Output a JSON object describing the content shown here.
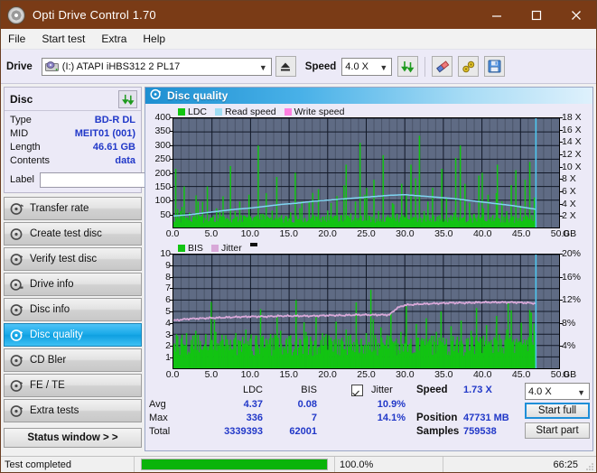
{
  "window": {
    "title": "Opti Drive Control 1.70",
    "icon": "disc-icon",
    "minimize": "minimize-icon",
    "maximize": "maximize-icon",
    "close": "close-icon"
  },
  "menu": {
    "items": [
      "File",
      "Start test",
      "Extra",
      "Help"
    ]
  },
  "toolbar": {
    "drive_label": "Drive",
    "drive_value": "(I:)  ATAPI iHBS312  2 PL17",
    "eject_icon": "eject-icon",
    "speed_label": "Speed",
    "speed_value": "4.0 X",
    "refresh_icon": "refresh-icon",
    "eraser_icon": "eraser-icon",
    "tools_icon": "tools-icon",
    "save_icon": "save-icon"
  },
  "disc_panel": {
    "title": "Disc",
    "refresh_icon": "refresh-icon",
    "rows": [
      {
        "key": "Type",
        "value": "BD-R DL"
      },
      {
        "key": "MID",
        "value": "MEIT01 (001)"
      },
      {
        "key": "Length",
        "value": "46.61 GB"
      },
      {
        "key": "Contents",
        "value": "data"
      }
    ],
    "label_key": "Label",
    "label_value": "",
    "label_placeholder": "",
    "disc_icon": "disc-small-icon"
  },
  "nav": {
    "items": [
      {
        "label": "Transfer rate",
        "icon": "disc-spin-icon",
        "active": false
      },
      {
        "label": "Create test disc",
        "icon": "disc-write-icon",
        "active": false
      },
      {
        "label": "Verify test disc",
        "icon": "disc-check-icon",
        "active": false
      },
      {
        "label": "Drive info",
        "icon": "drive-info-icon",
        "active": false
      },
      {
        "label": "Disc info",
        "icon": "disc-info-icon",
        "active": false
      },
      {
        "label": "Disc quality",
        "icon": "disc-quality-icon",
        "active": true
      },
      {
        "label": "CD Bler",
        "icon": "disc-bler-icon",
        "active": false
      },
      {
        "label": "FE / TE",
        "icon": "disc-fete-icon",
        "active": false
      },
      {
        "label": "Extra tests",
        "icon": "disc-extra-icon",
        "active": false
      }
    ],
    "status_button": "Status window > >"
  },
  "main": {
    "header_title": "Disc quality",
    "header_icon": "disc-quality-icon"
  },
  "stats": {
    "col_ldc": "LDC",
    "col_bis": "BIS",
    "row_avg": "Avg",
    "row_max": "Max",
    "row_total": "Total",
    "ldc_avg": "4.37",
    "ldc_max": "336",
    "ldc_total": "3339393",
    "bis_avg": "0.08",
    "bis_max": "7",
    "bis_total": "62001",
    "jitter_label": "Jitter",
    "jitter_checked": true,
    "jitter_avg": "10.9%",
    "jitter_max": "14.1%",
    "speed_label": "Speed",
    "speed_value": "1.73 X",
    "position_label": "Position",
    "position_value": "47731 MB",
    "samples_label": "Samples",
    "samples_value": "759538",
    "speed_select": "4.0 X",
    "start_full": "Start full",
    "start_part": "Start part"
  },
  "statusbar": {
    "message": "Test completed",
    "percent_label": "100.0%",
    "percent_value": 100,
    "elapsed": "66:25"
  },
  "colors": {
    "titlebar": "#7a3b16",
    "accent_blue": "#2138c8",
    "ldc_green": "#12c412",
    "read_speed": "#7fd4f0",
    "write_speed": "#ff7fe0",
    "bis_green": "#12c412",
    "jitter_pink": "#d8a8d8",
    "plot_bg": "#5f6b84",
    "progress_green": "#0ab40a",
    "nav_active": "#18a9e8"
  },
  "chart_data": [
    {
      "type": "line",
      "id": "top-chart",
      "title": "Disc quality",
      "legend": [
        {
          "name": "LDC",
          "color": "#12c412"
        },
        {
          "name": "Read speed",
          "color": "#7fd4f0"
        },
        {
          "name": "Write speed",
          "color": "#ff7fe0"
        }
      ],
      "legend_position": "top-left",
      "grid": true,
      "xlabel": "GB",
      "xlim": [
        0,
        50
      ],
      "xticks": [
        "0.0",
        "5.0",
        "10.0",
        "15.0",
        "20.0",
        "25.0",
        "30.0",
        "35.0",
        "40.0",
        "45.0",
        "50.0"
      ],
      "ylabel_left": "LDC",
      "ylim_left": [
        0,
        400
      ],
      "yticks_left": [
        "50",
        "100",
        "150",
        "200",
        "250",
        "300",
        "350",
        "400"
      ],
      "ylabel_right": "Speed",
      "ylim_right": [
        0,
        18
      ],
      "yticks_right": [
        "2 X",
        "4 X",
        "6 X",
        "8 X",
        "10 X",
        "12 X",
        "14 X",
        "16 X",
        "18 X"
      ],
      "series": [
        {
          "name": "Read speed",
          "color": "#7fd4f0",
          "axis": "right",
          "x": [
            0,
            2,
            4,
            6,
            8,
            10,
            12,
            14,
            16,
            18,
            20,
            22,
            24,
            26,
            28,
            30,
            32,
            34,
            36,
            38,
            40,
            42,
            44,
            46,
            47
          ],
          "values": [
            1.9,
            2.1,
            2.4,
            2.7,
            3.0,
            3.2,
            3.5,
            3.8,
            4.0,
            4.3,
            4.5,
            4.7,
            4.9,
            5.1,
            5.3,
            5.4,
            5.2,
            5.0,
            4.8,
            4.5,
            4.2,
            3.9,
            3.6,
            3.2,
            3.0
          ]
        },
        {
          "name": "LDC",
          "color": "#12c412",
          "axis": "left",
          "note": "dense vertical error spikes across 0-47 GB; baseline approx 20-60, peaks to 336",
          "baseline": 30,
          "peak_max": 336,
          "spikes": [
            [
              0.3,
              215
            ],
            [
              0.9,
              60
            ],
            [
              1.4,
              150
            ],
            [
              2.1,
              55
            ],
            [
              2.6,
              35
            ],
            [
              3.2,
              95
            ],
            [
              3.8,
              45
            ],
            [
              4.4,
              150
            ],
            [
              5.1,
              38
            ],
            [
              5.6,
              70
            ],
            [
              6.2,
              42
            ],
            [
              6.8,
              30
            ],
            [
              7.4,
              225
            ],
            [
              8.0,
              60
            ],
            [
              8.6,
              95
            ],
            [
              9.2,
              40
            ],
            [
              9.8,
              120
            ],
            [
              10.4,
              35
            ],
            [
              11.0,
              300
            ],
            [
              11.6,
              50
            ],
            [
              12.2,
              40
            ],
            [
              12.8,
              62
            ],
            [
              13.4,
              185
            ],
            [
              14.0,
              45
            ],
            [
              14.6,
              38
            ],
            [
              15.2,
              55
            ],
            [
              15.8,
              200
            ],
            [
              16.4,
              70
            ],
            [
              17.0,
              35
            ],
            [
              17.6,
              95
            ],
            [
              18.2,
              45
            ],
            [
              18.8,
              140
            ],
            [
              19.4,
              40
            ],
            [
              20.0,
              62
            ],
            [
              20.6,
              38
            ],
            [
              21.2,
              115
            ],
            [
              21.8,
              45
            ],
            [
              22.4,
              230
            ],
            [
              23.0,
              52
            ],
            [
              23.6,
              95
            ],
            [
              24.2,
              310
            ],
            [
              24.8,
              120
            ],
            [
              25.4,
              40
            ],
            [
              26.0,
              175
            ],
            [
              26.6,
              60
            ],
            [
              27.2,
              265
            ],
            [
              27.8,
              45
            ],
            [
              28.4,
              90
            ],
            [
              29.0,
              50
            ],
            [
              29.6,
              160
            ],
            [
              30.2,
              120
            ],
            [
              30.8,
              230
            ],
            [
              31.4,
              180
            ],
            [
              31.9,
              336
            ],
            [
              32.5,
              60
            ],
            [
              33.0,
              95
            ],
            [
              33.6,
              145
            ],
            [
              34.2,
              40
            ],
            [
              34.8,
              215
            ],
            [
              35.4,
              110
            ],
            [
              36.0,
              45
            ],
            [
              36.6,
              255
            ],
            [
              37.2,
              300
            ],
            [
              37.8,
              160
            ],
            [
              38.4,
              90
            ],
            [
              39.0,
              50
            ],
            [
              39.6,
              190
            ],
            [
              40.2,
              70
            ],
            [
              40.8,
              120
            ],
            [
              41.4,
              45
            ],
            [
              42.0,
              230
            ],
            [
              42.6,
              95
            ],
            [
              43.2,
              60
            ],
            [
              43.8,
              155
            ],
            [
              44.4,
              210
            ],
            [
              45.0,
              80
            ],
            [
              45.6,
              175
            ],
            [
              46.2,
              240
            ],
            [
              46.8,
              110
            ]
          ]
        },
        {
          "name": "Write speed",
          "color": "#ff7fe0",
          "axis": "right",
          "values": []
        }
      ],
      "markers": [
        {
          "type": "vline",
          "x": 47.0,
          "color": "#4ec8f0"
        }
      ]
    },
    {
      "type": "line",
      "id": "bottom-chart",
      "legend": [
        {
          "name": "BIS",
          "color": "#12c412"
        },
        {
          "name": "Jitter",
          "color": "#d8a8d8"
        }
      ],
      "legend_position": "top-left",
      "grid": true,
      "xlabel": "GB",
      "xlim": [
        0,
        50
      ],
      "xticks": [
        "0.0",
        "5.0",
        "10.0",
        "15.0",
        "20.0",
        "25.0",
        "30.0",
        "35.0",
        "40.0",
        "45.0",
        "50.0"
      ],
      "ylabel_left": "BIS",
      "ylim_left": [
        0,
        10
      ],
      "yticks_left": [
        "1",
        "2",
        "3",
        "4",
        "5",
        "6",
        "7",
        "8",
        "9",
        "10"
      ],
      "ylabel_right": "Jitter",
      "ylim_right": [
        0,
        20
      ],
      "yticks_right": [
        "4%",
        "8%",
        "12%",
        "16%",
        "20%"
      ],
      "series": [
        {
          "name": "Jitter",
          "color": "#d8a8d8",
          "axis": "right",
          "x": [
            0,
            2,
            4,
            6,
            8,
            10,
            12,
            14,
            16,
            18,
            20,
            22,
            24,
            26,
            28,
            29,
            30,
            32,
            34,
            36,
            38,
            40,
            42,
            44,
            46,
            47
          ],
          "values": [
            8.4,
            8.7,
            8.8,
            8.9,
            9.0,
            9.1,
            9.1,
            9.2,
            9.2,
            9.2,
            9.3,
            9.3,
            9.4,
            9.4,
            9.4,
            10.6,
            11.1,
            11.3,
            11.4,
            11.5,
            11.5,
            11.6,
            11.6,
            11.6,
            11.5,
            11.4
          ]
        },
        {
          "name": "BIS",
          "color": "#12c412",
          "axis": "left",
          "note": "dense vertical spikes, baseline ~2, peaks to 7",
          "baseline": 2,
          "peak_max": 7,
          "spikes": [
            [
              0.4,
              3.0
            ],
            [
              1.0,
              2.6
            ],
            [
              1.7,
              3.1
            ],
            [
              2.3,
              2.5
            ],
            [
              2.9,
              3.3
            ],
            [
              3.5,
              2.4
            ],
            [
              4.2,
              3.0
            ],
            [
              4.8,
              2.5
            ],
            [
              5.5,
              3.2
            ],
            [
              6.1,
              2.4
            ],
            [
              6.8,
              2.9
            ],
            [
              7.4,
              2.5
            ],
            [
              8.1,
              3.1
            ],
            [
              8.7,
              2.4
            ],
            [
              9.4,
              3.4
            ],
            [
              10.0,
              2.5
            ],
            [
              10.7,
              2.9
            ],
            [
              11.3,
              5.2
            ],
            [
              12.0,
              2.6
            ],
            [
              12.6,
              3.0
            ],
            [
              13.3,
              2.5
            ],
            [
              13.9,
              3.3
            ],
            [
              14.6,
              2.5
            ],
            [
              15.2,
              2.9
            ],
            [
              15.9,
              6.0
            ],
            [
              16.5,
              2.5
            ],
            [
              17.2,
              3.2
            ],
            [
              17.8,
              2.6
            ],
            [
              18.5,
              4.5
            ],
            [
              19.1,
              2.5
            ],
            [
              19.8,
              3.0
            ],
            [
              20.4,
              2.6
            ],
            [
              21.1,
              4.1
            ],
            [
              21.7,
              2.5
            ],
            [
              22.4,
              3.4
            ],
            [
              23.0,
              2.6
            ],
            [
              23.7,
              5.8
            ],
            [
              24.3,
              2.5
            ],
            [
              25.0,
              3.1
            ],
            [
              25.6,
              6.9
            ],
            [
              26.3,
              2.6
            ],
            [
              26.9,
              3.6
            ],
            [
              27.6,
              2.5
            ],
            [
              28.2,
              4.8
            ],
            [
              28.9,
              2.6
            ],
            [
              29.5,
              3.2
            ],
            [
              30.2,
              5.5
            ],
            [
              30.8,
              2.6
            ],
            [
              31.5,
              3.9
            ],
            [
              32.1,
              2.5
            ],
            [
              32.8,
              4.4
            ],
            [
              33.4,
              2.6
            ],
            [
              34.1,
              3.2
            ],
            [
              34.7,
              5.0
            ],
            [
              35.4,
              2.6
            ],
            [
              36.0,
              3.7
            ],
            [
              36.7,
              2.5
            ],
            [
              37.3,
              4.2
            ],
            [
              38.0,
              2.6
            ],
            [
              38.6,
              3.3
            ],
            [
              39.3,
              5.3
            ],
            [
              39.9,
              2.6
            ],
            [
              40.6,
              3.8
            ],
            [
              41.2,
              2.5
            ],
            [
              41.9,
              4.6
            ],
            [
              42.5,
              2.6
            ],
            [
              43.2,
              3.4
            ],
            [
              43.8,
              5.1
            ],
            [
              44.5,
              2.6
            ],
            [
              45.1,
              4.0
            ],
            [
              45.8,
              2.5
            ],
            [
              46.4,
              4.9
            ],
            [
              46.9,
              3.2
            ]
          ]
        }
      ],
      "markers": [
        {
          "type": "vline",
          "x": 47.0,
          "color": "#4ec8f0"
        }
      ]
    }
  ]
}
